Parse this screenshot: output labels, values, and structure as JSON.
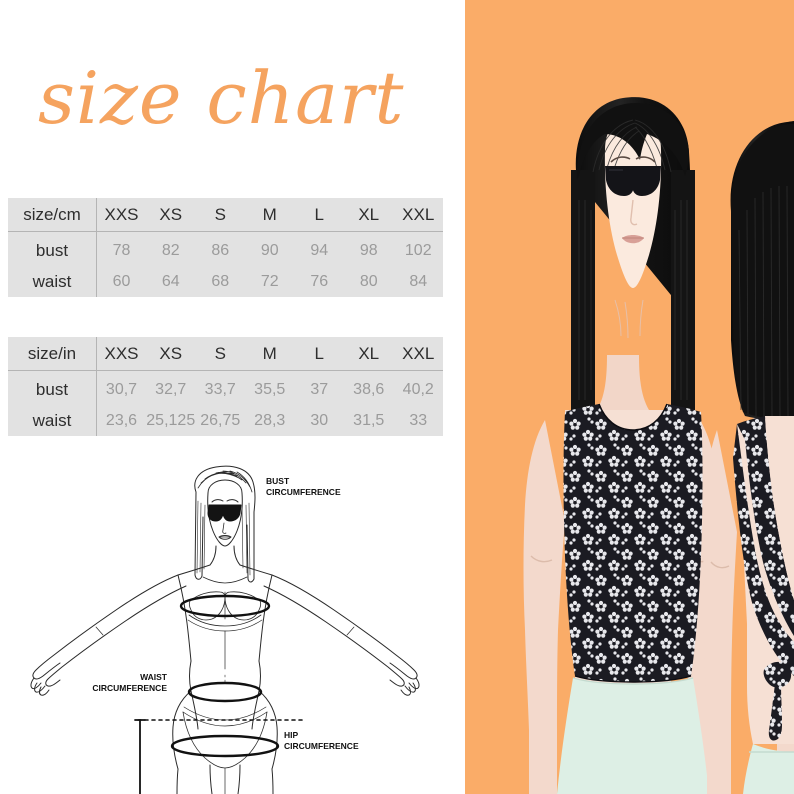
{
  "page": {
    "title": "size chart",
    "background_color": "#ffffff",
    "accent_color": "#faac68",
    "table_background_color": "#e2e2e2"
  },
  "tables": [
    {
      "id": "cm",
      "corner_label": "size/cm",
      "columns": [
        "XXS",
        "XS",
        "S",
        "M",
        "L",
        "XL",
        "XXL"
      ],
      "rows": [
        {
          "label": "bust",
          "values": [
            "78",
            "82",
            "86",
            "90",
            "94",
            "98",
            "102"
          ]
        },
        {
          "label": "waist",
          "values": [
            "60",
            "64",
            "68",
            "72",
            "76",
            "80",
            "84"
          ]
        }
      ]
    },
    {
      "id": "in",
      "corner_label": "size/in",
      "columns": [
        "XXS",
        "XS",
        "S",
        "M",
        "L",
        "XL",
        "XXL"
      ],
      "rows": [
        {
          "label": "bust",
          "values": [
            "30,7",
            "32,7",
            "33,7",
            "35,5",
            "37",
            "38,6",
            "40,2"
          ]
        },
        {
          "label": "waist",
          "values": [
            "23,6",
            "25,125",
            "26,75",
            "28,3",
            "30",
            "31,5",
            "33"
          ]
        }
      ]
    }
  ],
  "diagram": {
    "bust_label_line1": "BUST",
    "bust_label_line2": "CIRCUMFERENCE",
    "waist_label_line1": "WAIST",
    "waist_label_line2": "CIRCUMFERENCE",
    "hip_label_line1": "HIP",
    "hip_label_line2": "CIRCUMFERENCE"
  },
  "models": {
    "skin_color": "#f5ddd0",
    "hair_color": "#111111",
    "skirt_color": "#dcefe4",
    "top_base_color": "#1b1b22",
    "top_floral_color": "#e8e8ec"
  }
}
